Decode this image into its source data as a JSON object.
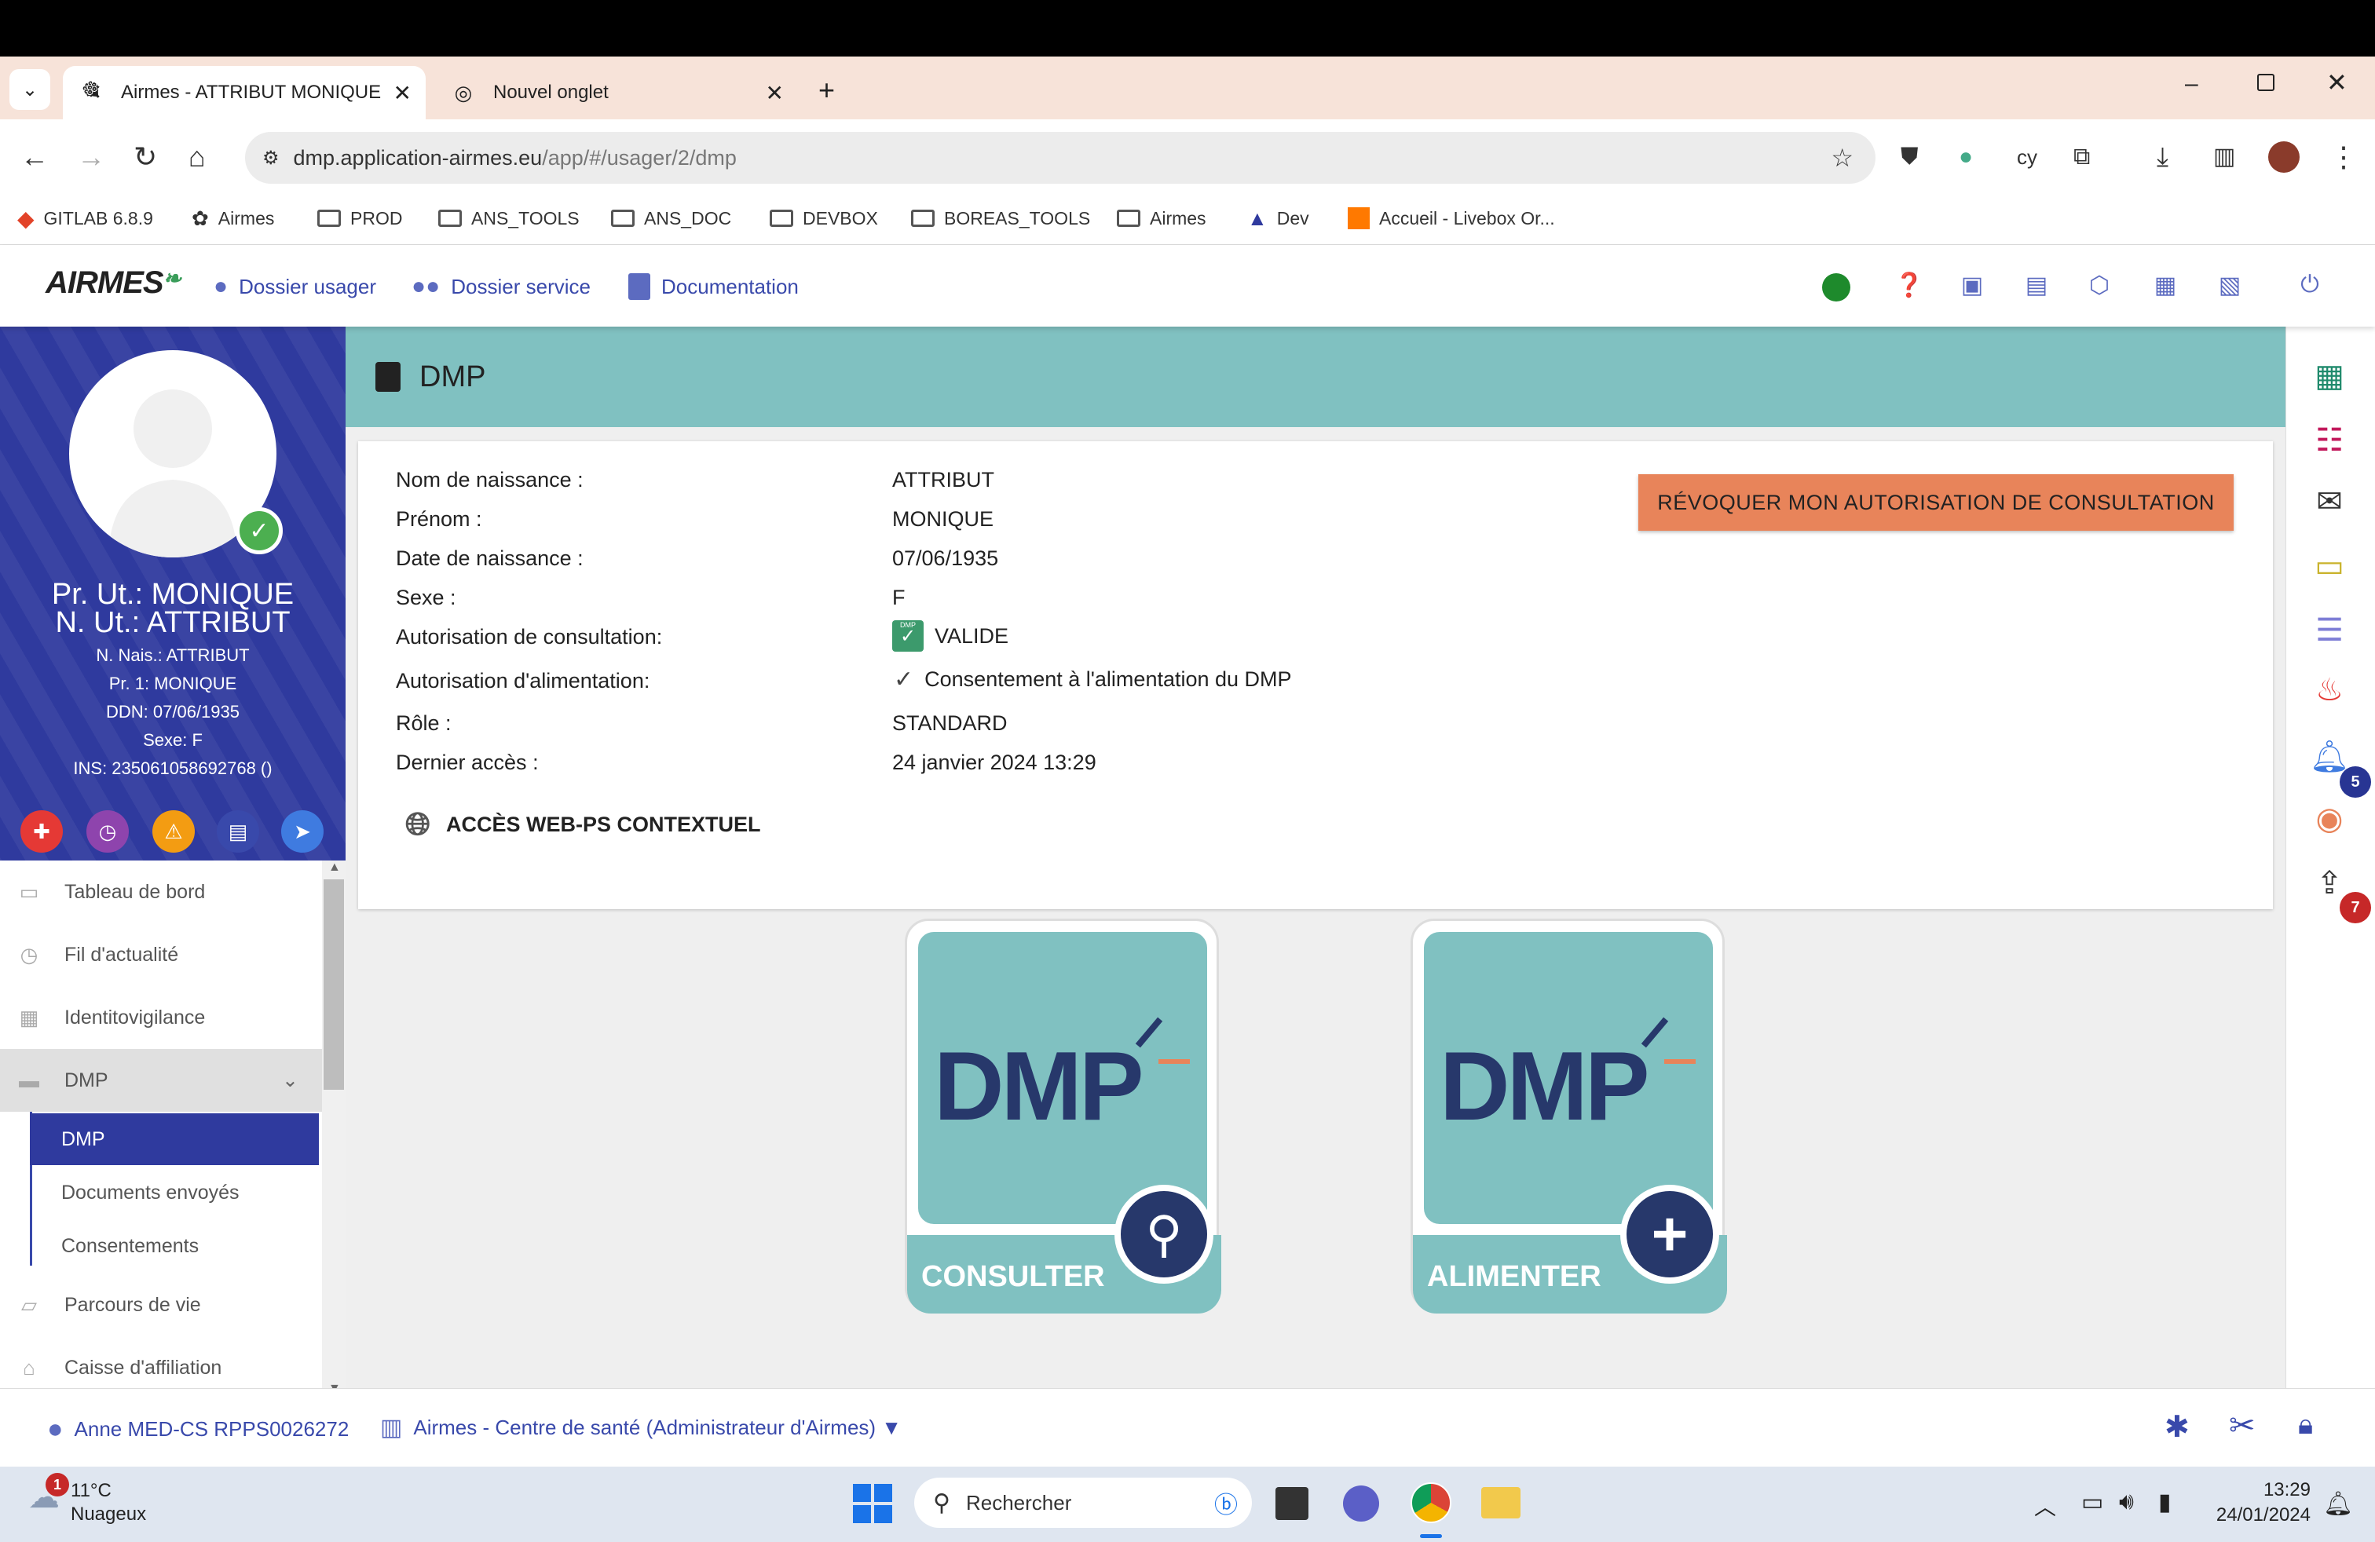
{
  "browser": {
    "tabs": [
      {
        "title": "Airmes - ATTRIBUT MONIQUE"
      },
      {
        "title": "Nouvel onglet"
      }
    ],
    "url_host": "dmp.application-airmes.eu",
    "url_path": "/app/#/usager/2/dmp",
    "bookmarks": [
      "GITLAB 6.8.9",
      "Airmes",
      "PROD",
      "ANS_TOOLS",
      "ANS_DOC",
      "DEVBOX",
      "BOREAS_TOOLS",
      "Airmes",
      "Dev",
      "Accueil - Livebox Or..."
    ]
  },
  "header": {
    "logo": "AIRMES",
    "links": [
      "Dossier usager",
      "Dossier service",
      "Documentation"
    ]
  },
  "profile": {
    "line1": "Pr. Ut.: MONIQUE",
    "line2": "N. Ut.: ATTRIBUT",
    "details": [
      "N. Nais.: ATTRIBUT",
      "Pr. 1: MONIQUE",
      "DDN: 07/06/1935",
      "Sexe: F",
      "INS: 235061058692768 ()"
    ]
  },
  "menu": {
    "items": [
      "Tableau de bord",
      "Fil d'actualité",
      "Identitovigilance",
      "DMP",
      "Parcours de vie",
      "Caisse d'affiliation"
    ],
    "sub": [
      "DMP",
      "Documents envoyés",
      "Consentements"
    ]
  },
  "page": {
    "title": "DMP",
    "rows": [
      {
        "label": "Nom de naissance :",
        "value": "ATTRIBUT"
      },
      {
        "label": "Prénom :",
        "value": "MONIQUE"
      },
      {
        "label": "Date de naissance :",
        "value": "07/06/1935"
      },
      {
        "label": "Sexe :",
        "value": "F"
      },
      {
        "label": "Autorisation de consultation:",
        "value": "VALIDE"
      },
      {
        "label": "Autorisation d'alimentation:",
        "value": "Consentement à l'alimentation du DMP"
      },
      {
        "label": "Rôle :",
        "value": "STANDARD"
      },
      {
        "label": "Dernier accès :",
        "value": "24 janvier 2024 13:29"
      }
    ],
    "dmp_icon_text": "DMP",
    "revoke_button": "RÉVOQUER MON AUTORISATION DE CONSULTATION",
    "web_ps": "ACCÈS WEB-PS CONTEXTUEL",
    "consulter": "CONSULTER",
    "alimenter": "ALIMENTER",
    "dmp_logo": "DMP"
  },
  "rightbar": {
    "bell_badge": "5",
    "upload_badge": "7"
  },
  "footer": {
    "user": "Anne MED-CS RPPS0026272",
    "structure": "Airmes - Centre de santé (Administrateur d'Airmes) ▼"
  },
  "taskbar": {
    "temp": "11°C",
    "weather": "Nuageux",
    "weather_badge": "1",
    "search": "Rechercher",
    "time": "13:29",
    "date": "24/01/2024"
  },
  "colors": {
    "primary": "#2f3a9e",
    "teal": "#80c1c1",
    "revoke": "#e8845a",
    "dmp_navy": "#27386b"
  }
}
